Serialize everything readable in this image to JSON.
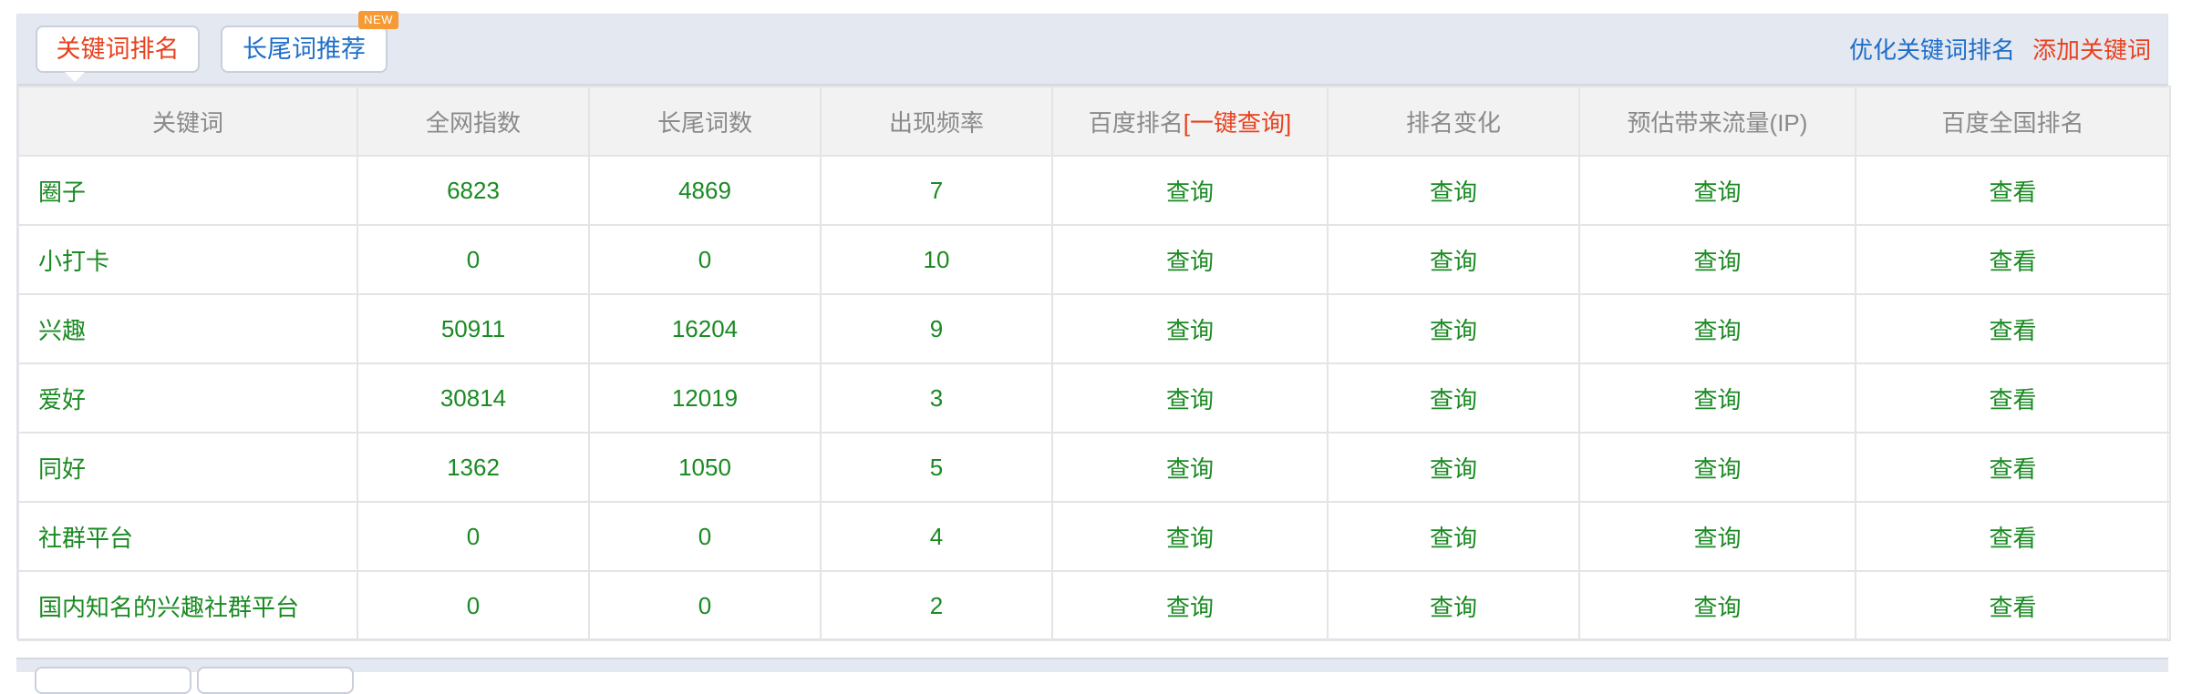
{
  "tabs": {
    "keyword_rank": "关键词排名",
    "longtail_recommend": "长尾词推荐",
    "new_badge": "NEW"
  },
  "links": {
    "optimize": "优化关键词排名",
    "add": "添加关键词"
  },
  "table": {
    "headers": {
      "keyword": "关键词",
      "index": "全网指数",
      "longtail": "长尾词数",
      "frequency": "出现频率",
      "baidu_rank": "百度排名",
      "quick_query": "[一键查询]",
      "rank_change": "排名变化",
      "traffic": "预估带来流量(IP)",
      "national_rank": "百度全国排名"
    },
    "rows": [
      {
        "keyword": "圈子",
        "index": "6823",
        "longtail": "4869",
        "frequency": "7",
        "baidu_rank": "查询",
        "rank_change": "查询",
        "traffic": "查询",
        "national_rank": "查看"
      },
      {
        "keyword": "小打卡",
        "index": "0",
        "longtail": "0",
        "frequency": "10",
        "baidu_rank": "查询",
        "rank_change": "查询",
        "traffic": "查询",
        "national_rank": "查看"
      },
      {
        "keyword": "兴趣",
        "index": "50911",
        "longtail": "16204",
        "frequency": "9",
        "baidu_rank": "查询",
        "rank_change": "查询",
        "traffic": "查询",
        "national_rank": "查看"
      },
      {
        "keyword": "爱好",
        "index": "30814",
        "longtail": "12019",
        "frequency": "3",
        "baidu_rank": "查询",
        "rank_change": "查询",
        "traffic": "查询",
        "national_rank": "查看"
      },
      {
        "keyword": "同好",
        "index": "1362",
        "longtail": "1050",
        "frequency": "5",
        "baidu_rank": "查询",
        "rank_change": "查询",
        "traffic": "查询",
        "national_rank": "查看"
      },
      {
        "keyword": "社群平台",
        "index": "0",
        "longtail": "0",
        "frequency": "4",
        "baidu_rank": "查询",
        "rank_change": "查询",
        "traffic": "查询",
        "national_rank": "查看"
      },
      {
        "keyword": "国内知名的兴趣社群平台",
        "index": "0",
        "longtail": "0",
        "frequency": "2",
        "baidu_rank": "查询",
        "rank_change": "查询",
        "traffic": "查询",
        "national_rank": "查看"
      }
    ]
  },
  "colors": {
    "accent_red": "#e8411d",
    "link_blue": "#1e6ec8",
    "value_green": "#1a8a22",
    "badge_orange": "#f59a34"
  }
}
